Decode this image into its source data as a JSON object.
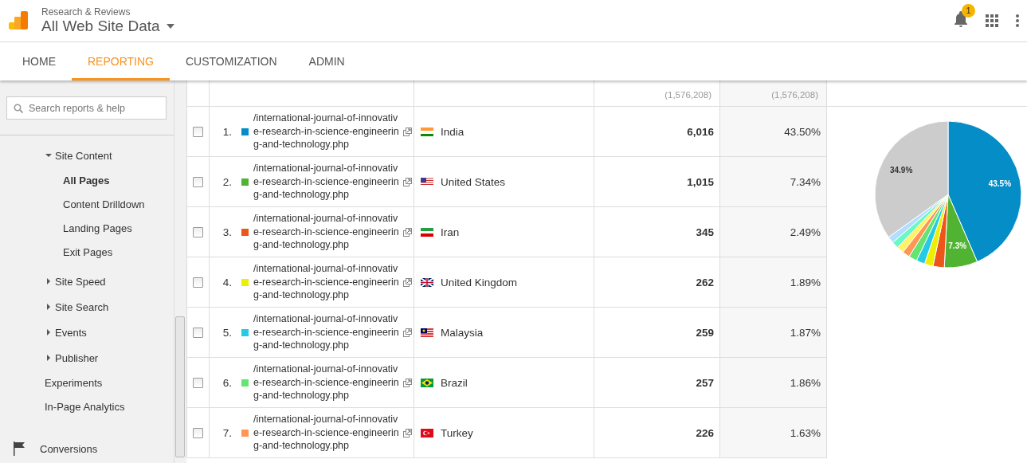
{
  "header": {
    "account": "Research & Reviews",
    "property": "All Web Site Data",
    "notification_count": "1"
  },
  "tabs": [
    {
      "label": "HOME",
      "selected": false
    },
    {
      "label": "REPORTING",
      "selected": true
    },
    {
      "label": "CUSTOMIZATION",
      "selected": false
    },
    {
      "label": "ADMIN",
      "selected": false
    }
  ],
  "sidebar": {
    "search": {
      "placeholder": "Search reports & help"
    },
    "items": [
      {
        "label": "Site Content",
        "kind": "group",
        "expanded": true,
        "children": [
          {
            "label": "All Pages",
            "selected": true
          },
          {
            "label": "Content Drilldown",
            "selected": false
          },
          {
            "label": "Landing Pages",
            "selected": false
          },
          {
            "label": "Exit Pages",
            "selected": false
          }
        ]
      },
      {
        "label": "Site Speed",
        "kind": "group",
        "expanded": false
      },
      {
        "label": "Site Search",
        "kind": "group",
        "expanded": false
      },
      {
        "label": "Events",
        "kind": "group",
        "expanded": false
      },
      {
        "label": "Publisher",
        "kind": "group",
        "expanded": false
      },
      {
        "label": "Experiments",
        "kind": "link"
      },
      {
        "label": "In-Page Analytics",
        "kind": "link"
      },
      {
        "label": "Conversions",
        "kind": "section"
      }
    ]
  },
  "table": {
    "totals": [
      "(1,576,208)",
      "(1,576,208)"
    ],
    "rows": [
      {
        "index": "1.",
        "color": "#058dc7",
        "page": "/international-journal-of-innovative-research-in-science-engineering-and-technology.php",
        "country": "India",
        "sessions": "6,016",
        "share": "43.50%",
        "checked": false
      },
      {
        "index": "2.",
        "color": "#50b432",
        "page": "/international-journal-of-innovative-research-in-science-engineering-and-technology.php",
        "country": "United States",
        "sessions": "1,015",
        "share": "7.34%",
        "checked": false
      },
      {
        "index": "3.",
        "color": "#ed561b",
        "page": "/international-journal-of-innovative-research-in-science-engineering-and-technology.php",
        "country": "Iran",
        "sessions": "345",
        "share": "2.49%",
        "checked": false
      },
      {
        "index": "4.",
        "color": "#edef00",
        "page": "/international-journal-of-innovative-research-in-science-engineering-and-technology.php",
        "country": "United Kingdom",
        "sessions": "262",
        "share": "1.89%",
        "checked": false
      },
      {
        "index": "5.",
        "color": "#24cbe5",
        "page": "/international-journal-of-innovative-research-in-science-engineering-and-technology.php",
        "country": "Malaysia",
        "sessions": "259",
        "share": "1.87%",
        "checked": false
      },
      {
        "index": "6.",
        "color": "#64e572",
        "page": "/international-journal-of-innovative-research-in-science-engineering-and-technology.php",
        "country": "Brazil",
        "sessions": "257",
        "share": "1.86%",
        "checked": false
      },
      {
        "index": "7.",
        "color": "#ff9655",
        "page": "/international-journal-of-innovative-research-in-science-engineering-and-technology.php",
        "country": "Turkey",
        "sessions": "226",
        "share": "1.63%",
        "checked": false
      }
    ]
  },
  "chart_data": {
    "type": "pie",
    "series": [
      {
        "values": [
          43.5,
          7.34,
          2.49,
          1.89,
          1.87,
          1.86,
          1.63,
          1.55,
          1.5,
          1.47,
          34.9
        ]
      }
    ],
    "colors": [
      "#058dc7",
      "#50b432",
      "#ed561b",
      "#edef00",
      "#24cbe5",
      "#64e572",
      "#ff9655",
      "#fff263",
      "#6af9c4",
      "#b2deff",
      "#cccccc"
    ],
    "value_labels": [
      "43.5%",
      "7.3%",
      null,
      null,
      null,
      null,
      null,
      null,
      null,
      null,
      "34.9%"
    ]
  }
}
